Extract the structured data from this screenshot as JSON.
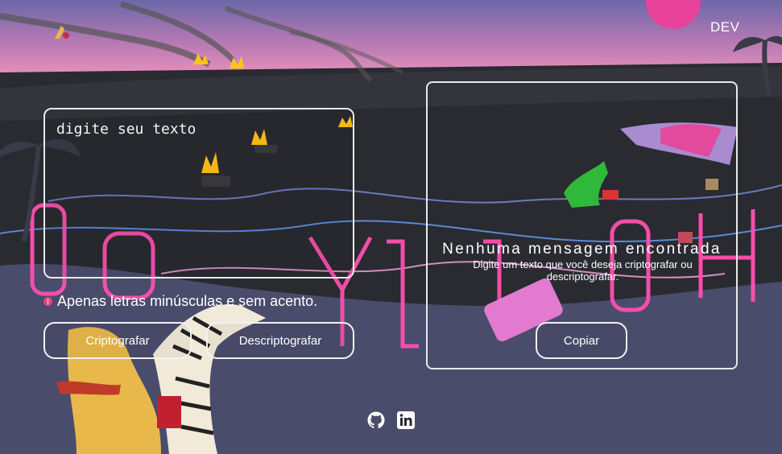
{
  "header": {
    "dev_label": "DEV"
  },
  "input": {
    "placeholder": "digite seu texto",
    "value": ""
  },
  "warning": {
    "text": "Apenas letras minúsculas e sem acento."
  },
  "buttons": {
    "encrypt_label": "Criptografar",
    "decrypt_label": "Descriptografar",
    "copy_label": "Copiar"
  },
  "output": {
    "title": "Nenhuma mensagem encontrada",
    "subtitle": "Digite um texto que você deseja criptografar ou descriptografar."
  },
  "footer": {
    "icons": [
      "github-icon",
      "linkedin-icon"
    ]
  },
  "colors": {
    "accent": "#e9447c",
    "sky_top": "#6a6aa6",
    "sky_bottom": "#d07ab0",
    "neon": "#ff4fb0"
  }
}
